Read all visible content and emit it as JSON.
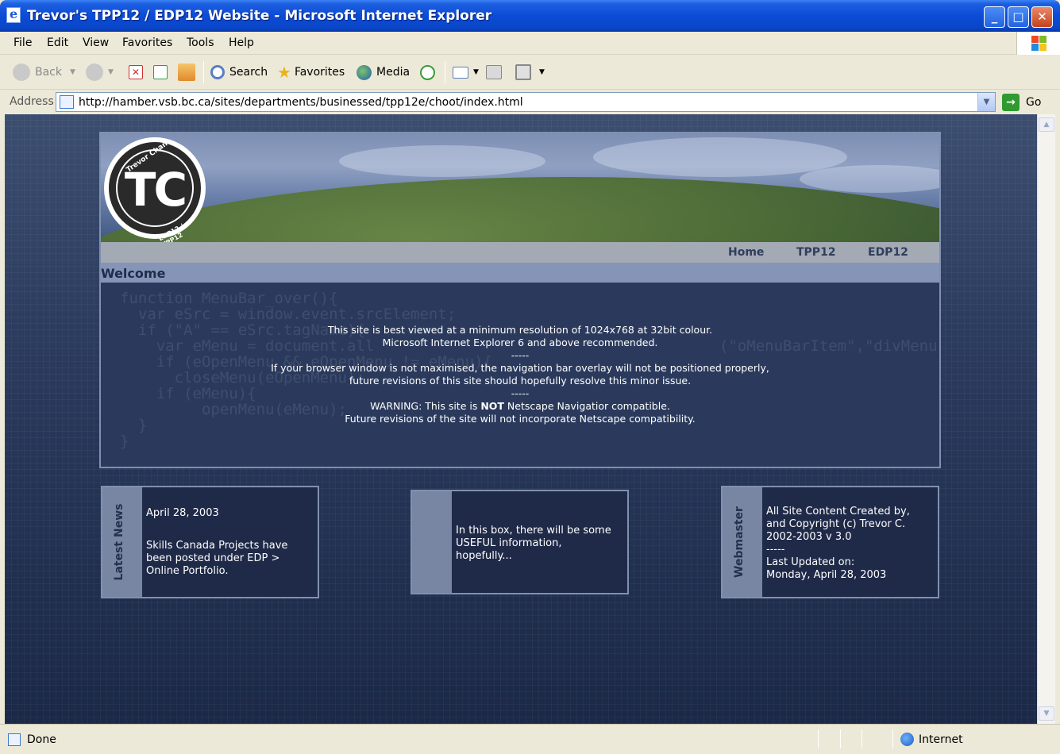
{
  "window": {
    "title": "Trevor's TPP12 / EDP12 Website - Microsoft Internet Explorer",
    "minimize_glyph": "_",
    "maximize_glyph": "□",
    "close_glyph": "✕"
  },
  "menubar": {
    "items": [
      "File",
      "Edit",
      "View",
      "Favorites",
      "Tools",
      "Help"
    ]
  },
  "toolbar": {
    "back_label": "Back",
    "search_label": "Search",
    "favorites_label": "Favorites",
    "media_label": "Media"
  },
  "address": {
    "label": "Address",
    "url": "http://hamber.vsb.bc.ca/sites/departments/businessed/tpp12e/choot/index.html",
    "go_label": "Go"
  },
  "site": {
    "logo": {
      "initials": "TC",
      "top_text": "Trevor Chan",
      "bottom_text": "EDP12 / TPP12"
    },
    "nav": [
      "Home",
      "TPP12",
      "EDP12"
    ],
    "welcome_heading": "Welcome",
    "notice": {
      "line1": "This site is best viewed at a minimum resolution of 1024x768 at 32bit colour.",
      "line2": "Microsoft Internet Explorer 6 and above recommended.",
      "sep1": "-----",
      "line3": "If your browser window is not maximised, the navigation bar overlay will not be positioned properly,",
      "line4": "future revisions of this site should hopefully resolve this minor issue.",
      "sep2": "-----",
      "warning_prefix": "WARNING: This site is ",
      "warning_emphasis": "NOT",
      "warning_suffix": " Netscape Navigatior compatible.",
      "line6": "Future revisions of the site will not incorporate Netscape compatibility."
    },
    "boxes": {
      "news": {
        "label": "Latest News",
        "date": "April 28, 2003",
        "text1": "Skills Canada Projects have",
        "text2": "been posted under EDP >",
        "text3": "Online Portfolio."
      },
      "info": {
        "text1": "In this box, there will be some",
        "text2": "USEFUL information,",
        "text3": "hopefully..."
      },
      "webmaster": {
        "label": "Webmaster",
        "text1": "All Site Content Created by,",
        "text2": "and Copyright (c) Trevor C.",
        "text3": "2002-2003 v 3.0",
        "text4": "-----",
        "text5": "Last Updated on:",
        "text6": "Monday, April 28, 2003"
      }
    }
  },
  "status": {
    "text": "Done",
    "zone": "Internet"
  }
}
